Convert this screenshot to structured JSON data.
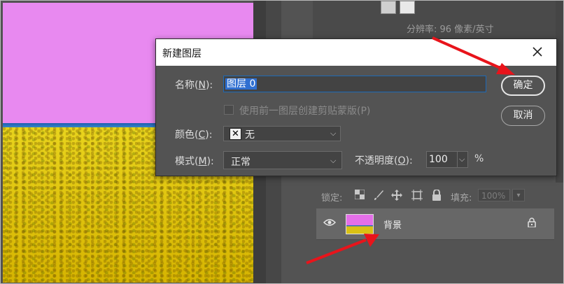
{
  "panel": {
    "resolution_text": "分辨率: 96 像素/英寸",
    "lock_label": "锁定:",
    "fill_label": "填充:",
    "fill_value": "100%",
    "icons": [
      "transparency-lock-icon",
      "brush-icon",
      "move-icon",
      "artboard-icon",
      "lock-icon"
    ]
  },
  "layer": {
    "name": "背景",
    "visibility_icon": "eye-icon",
    "lock_icon": "lock-icon"
  },
  "dialog": {
    "title": "新建图层",
    "close_icon": "close-icon",
    "name_label": "名称",
    "name_key": "N",
    "name_value": "图层 0",
    "clipping_checkbox_label": "使用前一图层创建剪贴蒙版(P)",
    "color_label": "颜色",
    "color_key": "C",
    "color_value": "无",
    "mode_label": "模式",
    "mode_key": "M",
    "mode_value": "正常",
    "opacity_label": "不透明度",
    "opacity_key": "O",
    "opacity_value": "100",
    "percent_sign": "%",
    "ok_label": "确定",
    "cancel_label": "取消"
  },
  "colors": {
    "panel_bg": "#535353",
    "selection": "#2f6fd1",
    "annotation_arrow": "#e8141b"
  }
}
